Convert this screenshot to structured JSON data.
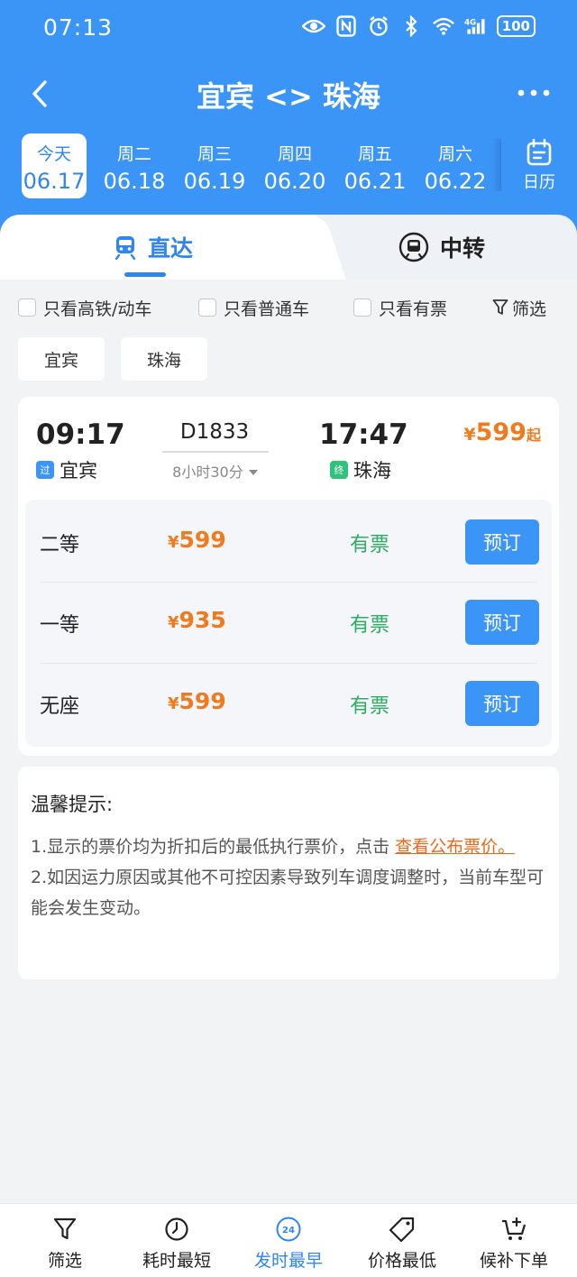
{
  "status": {
    "time": "07:13",
    "battery": "100",
    "network": "4G"
  },
  "header": {
    "title": "宜宾 <> 珠海"
  },
  "dates": [
    {
      "weekday": "今天",
      "date": "06.17",
      "active": true
    },
    {
      "weekday": "周二",
      "date": "06.18"
    },
    {
      "weekday": "周三",
      "date": "06.19"
    },
    {
      "weekday": "周四",
      "date": "06.20"
    },
    {
      "weekday": "周五",
      "date": "06.21"
    },
    {
      "weekday": "周六",
      "date": "06.22"
    }
  ],
  "calendar_label": "日历",
  "tabs": {
    "direct": "直达",
    "transfer": "中转"
  },
  "filters": {
    "highspeed": "只看高铁/动车",
    "normal": "只看普通车",
    "available": "只看有票",
    "filter": "筛选"
  },
  "stations": {
    "from": "宜宾",
    "to": "珠海"
  },
  "train": {
    "dep_time": "09:17",
    "dep_tag": "过",
    "dep_station": "宜宾",
    "number": "D1833",
    "duration": "8小时30分",
    "arr_time": "17:47",
    "arr_tag": "终",
    "arr_station": "珠海",
    "price_symbol": "¥",
    "min_price": "599",
    "price_suffix": "起",
    "seats": [
      {
        "name": "二等",
        "symbol": "¥",
        "price": "599",
        "status": "有票",
        "action": "预订"
      },
      {
        "name": "一等",
        "symbol": "¥",
        "price": "935",
        "status": "有票",
        "action": "预订"
      },
      {
        "name": "无座",
        "symbol": "¥",
        "price": "599",
        "status": "有票",
        "action": "预订"
      }
    ]
  },
  "tips": {
    "title": "温馨提示:",
    "line1": "1.显示的票价均为折扣后的最低执行票价，点击 ",
    "link": "查看公布票价。",
    "line2": "2.如因运力原因或其他不可控因素导致列车调度调整时，当前车型可能会发生变动。"
  },
  "bottom_nav": [
    {
      "label": "筛选",
      "icon": "filter-icon"
    },
    {
      "label": "耗时最短",
      "icon": "timer-icon"
    },
    {
      "label": "发时最早",
      "icon": "clock-24-icon",
      "active": true
    },
    {
      "label": "价格最低",
      "icon": "price-tag-icon"
    },
    {
      "label": "候补下单",
      "icon": "cart-plus-icon"
    }
  ],
  "colors": {
    "primary": "#3b95f6",
    "price": "#f07a1e",
    "available": "#2cae62"
  }
}
